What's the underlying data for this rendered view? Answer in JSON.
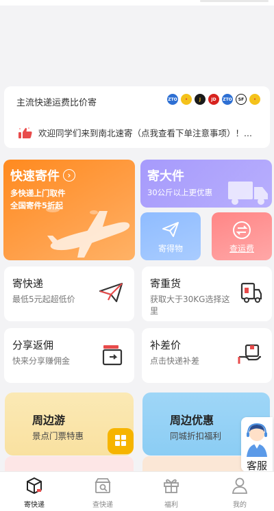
{
  "compare": {
    "title": "主流快递运费比价寄",
    "carriers": [
      {
        "text": "ZTO",
        "color": "#2d6fd3"
      },
      {
        "text": "•",
        "color": "#f4c21b"
      },
      {
        "text": "J",
        "color": "#1a1a1a"
      },
      {
        "text": "JD",
        "color": "#d7231f"
      },
      {
        "text": "ZTO",
        "color": "#2d6fd3"
      },
      {
        "text": "SF",
        "color": "#1a1a1a"
      },
      {
        "text": "•",
        "color": "#f4c21b"
      }
    ],
    "notice": "欢迎同学们来到南北速寄（点我查看下单注意事项）！..."
  },
  "feature": {
    "express_title": "快速寄件",
    "express_line1": "多快递上门取件",
    "express_line2": "全国寄件5折起",
    "bulky_title": "寄大件",
    "bulky_sub": "30公斤以上更优惠",
    "send_goods": "寄得物",
    "check_freight": "查运费"
  },
  "services": [
    {
      "title": "寄快递",
      "sub": "最低5元起超低价"
    },
    {
      "title": "寄重货",
      "sub": "获取大于30KG选择这里"
    },
    {
      "title": "分享返佣",
      "sub": "快来分享赚佣金"
    },
    {
      "title": "补差价",
      "sub": "点击快递补差"
    }
  ],
  "promos": {
    "tour_title": "周边游",
    "tour_sub": "景点门票特惠",
    "deals_title": "周边优惠",
    "deals_sub": "同城折扣福利"
  },
  "customer_service": "客服",
  "tabs": [
    {
      "label": "寄快递",
      "icon": "box-icon",
      "active": true
    },
    {
      "label": "查快递",
      "icon": "truck-search-icon",
      "active": false
    },
    {
      "label": "福利",
      "icon": "gift-icon",
      "active": false
    },
    {
      "label": "我的",
      "icon": "person-icon",
      "active": false
    }
  ]
}
